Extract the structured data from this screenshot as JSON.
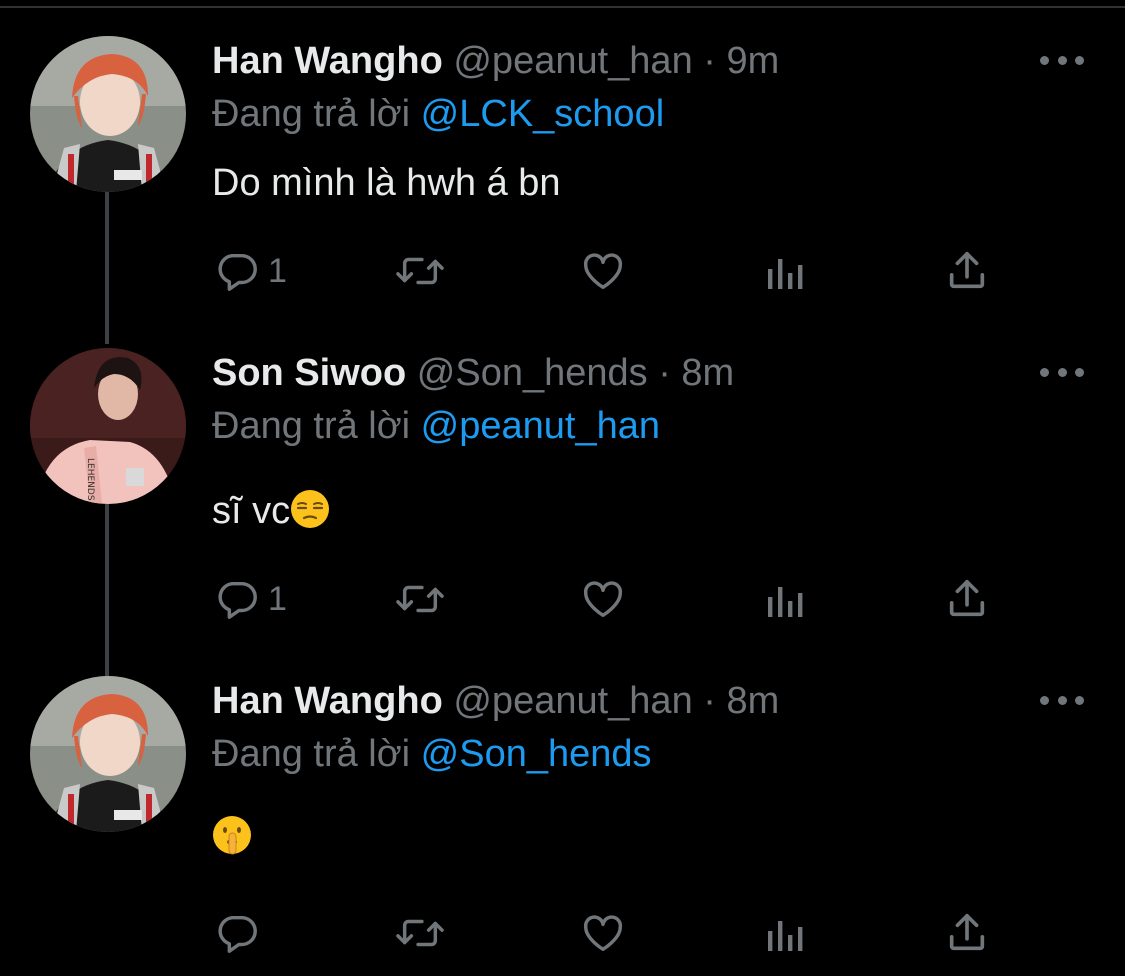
{
  "colors": {
    "background": "#000000",
    "text": "#e7e9ea",
    "muted": "#71767b",
    "link": "#1d9bf0",
    "thread_line": "#3e4144"
  },
  "tweets": [
    {
      "name": "Han Wangho",
      "handle": "@peanut_han",
      "separator": "·",
      "time": "9m",
      "reply_prefix": "Đang trả lời",
      "reply_to": "@LCK_school",
      "text": "Do mình là hwh á bn",
      "reply_count": "1",
      "icons": [
        "reply-icon",
        "retweet-icon",
        "like-icon",
        "analytics-icon",
        "share-icon",
        "more-icon"
      ]
    },
    {
      "name": "Son Siwoo",
      "handle": "@Son_hends",
      "separator": "·",
      "time": "8m",
      "reply_prefix": "Đang trả lời",
      "reply_to": "@peanut_han",
      "text": "sĩ vc",
      "emoji": "unamused-face-emoji",
      "reply_count": "1",
      "icons": [
        "reply-icon",
        "retweet-icon",
        "like-icon",
        "analytics-icon",
        "share-icon",
        "more-icon"
      ]
    },
    {
      "name": "Han Wangho",
      "handle": "@peanut_han",
      "separator": "·",
      "time": "8m",
      "reply_prefix": "Đang trả lời",
      "reply_to": "@Son_hends",
      "text": "",
      "emoji": "shushing-face-emoji",
      "reply_count": "",
      "icons": [
        "reply-icon",
        "retweet-icon",
        "like-icon",
        "analytics-icon",
        "share-icon",
        "more-icon"
      ]
    }
  ]
}
